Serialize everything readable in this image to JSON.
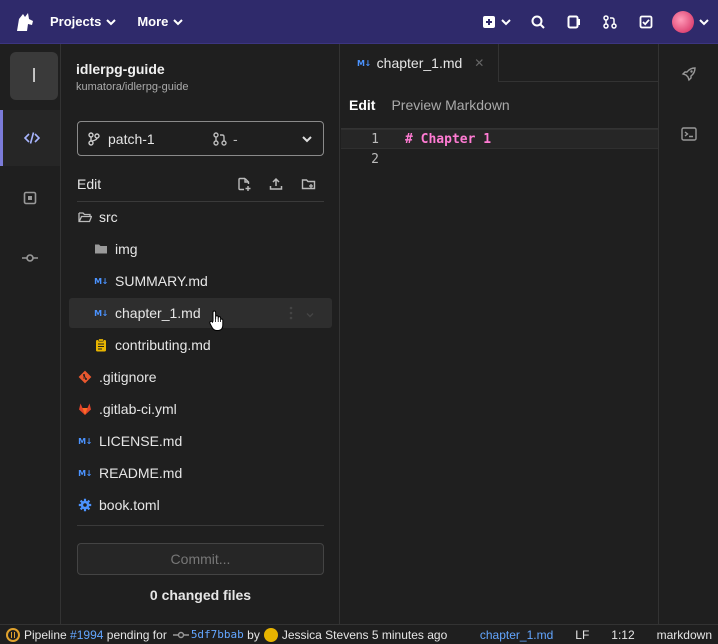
{
  "nav": {
    "projects_label": "Projects",
    "more_label": "More"
  },
  "project": {
    "avatar_letter": "I",
    "name": "idlerpg-guide",
    "path": "kumatora/idlerpg-guide"
  },
  "branch": {
    "name": "patch-1",
    "merge_request": "-"
  },
  "tree_header": {
    "label": "Edit"
  },
  "files": [
    {
      "name": "src",
      "icon": "folder-open-icon"
    },
    {
      "name": "img",
      "icon": "folder-icon"
    },
    {
      "name": "SUMMARY.md",
      "icon": "markdown-icon"
    },
    {
      "name": "chapter_1.md",
      "icon": "markdown-icon"
    },
    {
      "name": "contributing.md",
      "icon": "clipboard-icon"
    },
    {
      "name": ".gitignore",
      "icon": "git-icon"
    },
    {
      "name": ".gitlab-ci.yml",
      "icon": "gitlab-icon"
    },
    {
      "name": "LICENSE.md",
      "icon": "markdown-icon"
    },
    {
      "name": "README.md",
      "icon": "markdown-icon"
    },
    {
      "name": "book.toml",
      "icon": "gear-icon"
    }
  ],
  "commit": {
    "button_label": "Commit...",
    "changed_files": "0 changed files"
  },
  "editor": {
    "tab_name": "chapter_1.md",
    "mode_edit": "Edit",
    "mode_preview": "Preview Markdown",
    "lines": [
      {
        "number": "1",
        "text": "# Chapter 1"
      },
      {
        "number": "2",
        "text": ""
      }
    ]
  },
  "status": {
    "pipeline_prefix": "Pipeline",
    "pipeline_id": "#1994",
    "pipeline_state": "pending for",
    "commit_sha": "5df7bbab",
    "by": "by",
    "author": "Jessica Stevens",
    "time": "5 minutes ago",
    "file": "chapter_1.md",
    "line_ending": "LF",
    "position": "1:12",
    "language": "markdown"
  },
  "colors": {
    "navbar": "#2f2a6b",
    "accent_link": "#63a6ff",
    "markdown_heading": "#ff7bd3",
    "pending": "#e0a22d"
  }
}
